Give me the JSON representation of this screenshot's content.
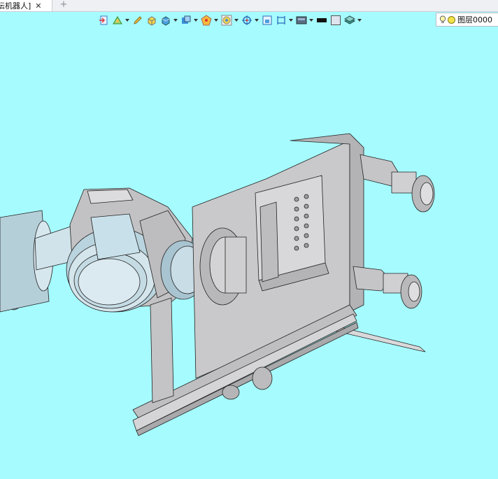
{
  "tabs": [
    {
      "title": "伝机器人]",
      "active": true
    }
  ],
  "tab_add_label": "+",
  "toolbar": {
    "icons": [
      "exit-sketch-icon",
      "sketch-tools-icon",
      "edit-pencil-icon",
      "extrude-solid-icon",
      "box-shading-icon",
      "face-select-icon",
      "palette-icon",
      "view-orient-icon",
      "move-origin-icon",
      "section-icon",
      "dimension-icon",
      "display-mode-icon",
      "color-black-icon",
      "color-swatch-icon",
      "layers-stack-icon"
    ]
  },
  "layer": {
    "label": "图层0000"
  },
  "colors": {
    "viewport_background": "#a6fbff",
    "part_grey": "#c7c7c9",
    "part_blue": "#bcd6df"
  }
}
